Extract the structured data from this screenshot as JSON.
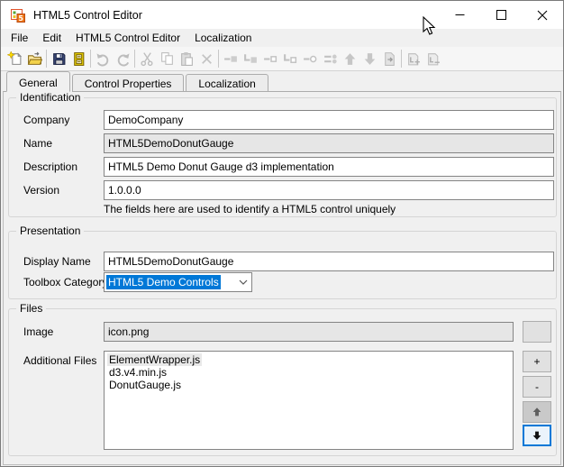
{
  "window": {
    "title": "HTML5 Control Editor"
  },
  "menu": {
    "items": [
      "File",
      "Edit",
      "HTML5 Control Editor",
      "Localization"
    ]
  },
  "toolbar": {
    "items": [
      {
        "name": "new-control",
        "enabled": true
      },
      {
        "name": "open-control",
        "enabled": true
      },
      {
        "sep": true
      },
      {
        "name": "save",
        "enabled": true
      },
      {
        "name": "save-archive",
        "enabled": true
      },
      {
        "sep": true
      },
      {
        "name": "undo",
        "enabled": false
      },
      {
        "name": "redo",
        "enabled": false
      },
      {
        "sep": true
      },
      {
        "name": "cut",
        "enabled": false
      },
      {
        "name": "copy",
        "enabled": false
      },
      {
        "name": "paste",
        "enabled": false
      },
      {
        "name": "delete",
        "enabled": false
      },
      {
        "sep": true
      },
      {
        "name": "attach-line-solid",
        "enabled": false
      },
      {
        "name": "attach-corner-solid",
        "enabled": false
      },
      {
        "name": "attach-line-hollow",
        "enabled": false
      },
      {
        "name": "attach-corner-hollow",
        "enabled": false
      },
      {
        "name": "attach-circle",
        "enabled": false
      },
      {
        "name": "bind-list",
        "enabled": false
      },
      {
        "name": "move-up",
        "enabled": false
      },
      {
        "name": "move-down",
        "enabled": false
      },
      {
        "name": "export-document",
        "enabled": false
      },
      {
        "sep": true
      },
      {
        "name": "add-localization-file",
        "enabled": false
      },
      {
        "name": "remove-localization-file",
        "enabled": false
      }
    ]
  },
  "tabs": {
    "items": [
      {
        "label": "General",
        "active": true
      },
      {
        "label": "Control Properties",
        "active": false
      },
      {
        "label": "Localization",
        "active": false
      }
    ]
  },
  "identification": {
    "legend": "Identification",
    "fields": [
      {
        "label": "Company",
        "value": "DemoCompany",
        "state": "enabled"
      },
      {
        "label": "Name",
        "value": "HTML5DemoDonutGauge",
        "state": "disabled"
      },
      {
        "label": "Description",
        "value": "HTML5 Demo Donut Gauge d3 implementation",
        "state": "enabled"
      },
      {
        "label": "Version",
        "value": "1.0.0.0",
        "state": "enabled"
      }
    ],
    "hint": "The fields here are used to identify a HTML5 control uniquely"
  },
  "presentation": {
    "legend": "Presentation",
    "display_name": {
      "label": "Display Name",
      "value": "HTML5DemoDonutGauge"
    },
    "toolbox_category": {
      "label": "Toolbox Category",
      "value": "HTML5 Demo Controls",
      "selected": true
    }
  },
  "files": {
    "legend": "Files",
    "image": {
      "label": "Image",
      "value": "icon.png",
      "state": "disabled"
    },
    "browse_button_label": "",
    "additional": {
      "label": "Additional Files",
      "items": [
        "ElementWrapper.js",
        "d3.v4.min.js",
        "DonutGauge.js"
      ],
      "selected_index": 0
    },
    "list_buttons": [
      {
        "name": "add-file",
        "label": "+"
      },
      {
        "name": "remove-file",
        "label": "-"
      },
      {
        "name": "move-file-up",
        "icon": "arrow-up",
        "state": "up-state"
      },
      {
        "name": "move-file-down",
        "icon": "arrow-down",
        "focused": true
      }
    ]
  },
  "colors": {
    "selection": "#0078d7",
    "focus_border": "#0078d7",
    "window_bg": "#f0f0f0"
  }
}
